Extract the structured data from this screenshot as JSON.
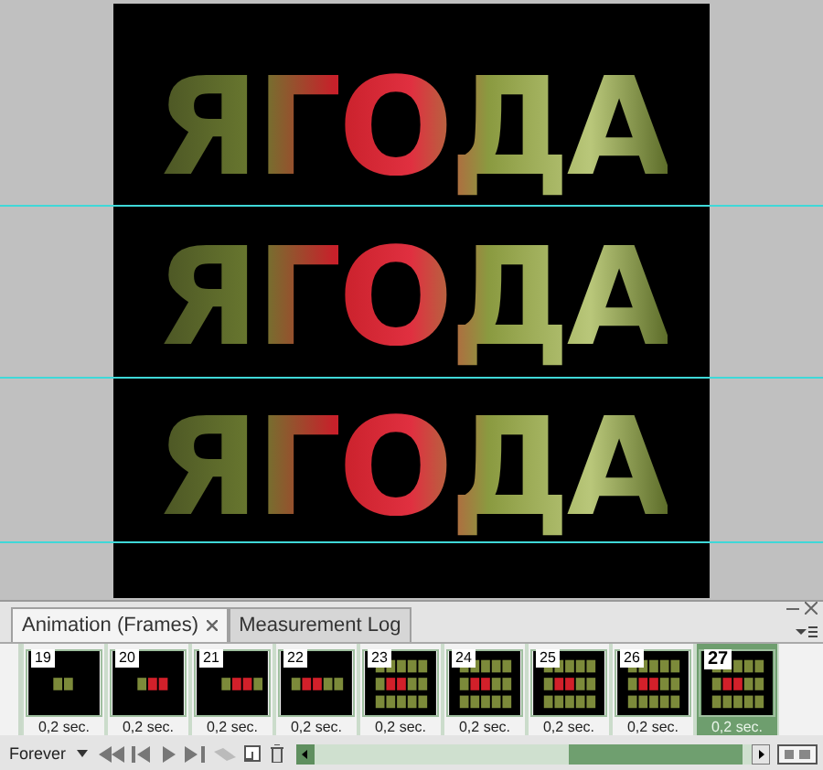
{
  "canvas": {
    "lines": [
      "ЯГОДА",
      "ЯГОДА",
      "ЯГОДА"
    ]
  },
  "panel": {
    "tabs": [
      {
        "label": "Animation (Frames)",
        "selected": true,
        "closable": true
      },
      {
        "label": "Measurement Log",
        "selected": false,
        "closable": false
      }
    ],
    "frames": [
      {
        "number": "19",
        "delay": "0,2 sec.",
        "selected": false
      },
      {
        "number": "20",
        "delay": "0,2 sec.",
        "selected": false
      },
      {
        "number": "21",
        "delay": "0,2 sec.",
        "selected": false
      },
      {
        "number": "22",
        "delay": "0,2 sec.",
        "selected": false
      },
      {
        "number": "23",
        "delay": "0,2 sec.",
        "selected": false
      },
      {
        "number": "24",
        "delay": "0,2 sec.",
        "selected": false
      },
      {
        "number": "25",
        "delay": "0,2 sec.",
        "selected": false
      },
      {
        "number": "26",
        "delay": "0,2 sec.",
        "selected": false
      },
      {
        "number": "27",
        "delay": "0,2 sec.",
        "selected": true
      }
    ],
    "loop": "Forever"
  }
}
